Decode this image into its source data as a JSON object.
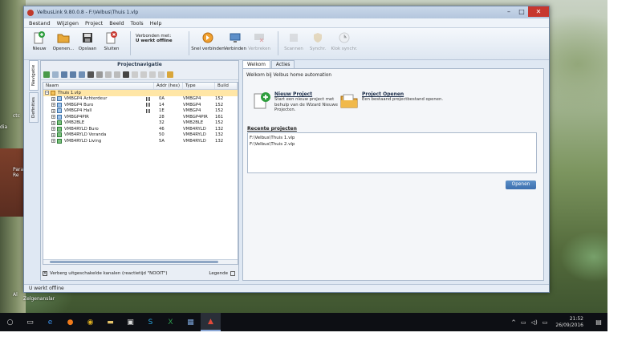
{
  "desktop": {
    "labels": [
      "ctc",
      "Para",
      "Re",
      "dia",
      "Al",
      "Zelgenanslar"
    ]
  },
  "window": {
    "title": "VelbusLink 9.80.0.8 - F:\\Velbus\\Thuis 1.vlp"
  },
  "menu": [
    "Bestand",
    "Wijzigen",
    "Project",
    "Beeld",
    "Tools",
    "Help"
  ],
  "toolbar": {
    "nieuw": "Nieuw",
    "openen": "Openen...",
    "opslaan": "Opslaan",
    "sluiten": "Sluiten",
    "conn_label": "Verbonden met:",
    "conn_status": "U werkt offline",
    "snel": "Snel verbinden",
    "verbinden": "Verbinden",
    "verbreken": "Verbreken",
    "scannen": "Scannen",
    "synch": "Synchr.",
    "klok": "Klok synchr."
  },
  "sidetabs": [
    "Navigatie",
    "Definities"
  ],
  "left": {
    "title": "Projectnavigatie",
    "columns": {
      "naam": "Naam",
      "addr": "Addr (hex)",
      "type": "Type",
      "build": "Build"
    },
    "rows": [
      {
        "name": "Thuis 1.vlp",
        "addr": "",
        "type": "",
        "build": ""
      },
      {
        "name": "VMBGP4 Achterdeur",
        "addr": "0A",
        "type": "VMBGP4",
        "build": "152"
      },
      {
        "name": "VMBGP4 Buro",
        "addr": "14",
        "type": "VMBGP4",
        "build": "152"
      },
      {
        "name": "VMBGP4 Hall",
        "addr": "1E",
        "type": "VMBGP4",
        "build": "152"
      },
      {
        "name": "VMBGP4PIR",
        "addr": "28",
        "type": "VMBGP4PIR",
        "build": "161"
      },
      {
        "name": "VMB2BLE",
        "addr": "32",
        "type": "VMB2BLE",
        "build": "152"
      },
      {
        "name": "VMB4RYLD Buro",
        "addr": "46",
        "type": "VMB4RYLD",
        "build": "132"
      },
      {
        "name": "VMB4RYLD Veranda",
        "addr": "50",
        "type": "VMB4RYLD",
        "build": "132"
      },
      {
        "name": "VMB4RYLD Living",
        "addr": "5A",
        "type": "VMB4RYLD",
        "build": "132"
      }
    ],
    "footer_check": "Verberg uitgeschakelde kanalen (reactietijd \"NOOIT\")",
    "legend": "Legende"
  },
  "right": {
    "tabs": [
      "Welkom",
      "Acties"
    ],
    "welcome": "Welkom bij Velbus home automation",
    "new_title": "Nieuw Project",
    "new_desc_1": "Start een nieuw project met",
    "new_desc_2": "behulp van de Wizard Nieuwe",
    "new_desc_3": "Projecten.",
    "open_title": "Project Openen",
    "open_desc": "Een bestaand projectbestand openen.",
    "recent_title": "Recente projecten",
    "recent": [
      "F:\\Velbus\\Thuis 1.vlp",
      "F:\\Velbus\\Thuis 2.vlp"
    ],
    "open_button": "Openen"
  },
  "status": "U werkt offline",
  "taskbar": {
    "time": "21:52",
    "date": "26/09/2016"
  },
  "colors": {
    "accent": "#3c6fae",
    "selection": "#ffe6a6",
    "close": "#c7372f"
  }
}
